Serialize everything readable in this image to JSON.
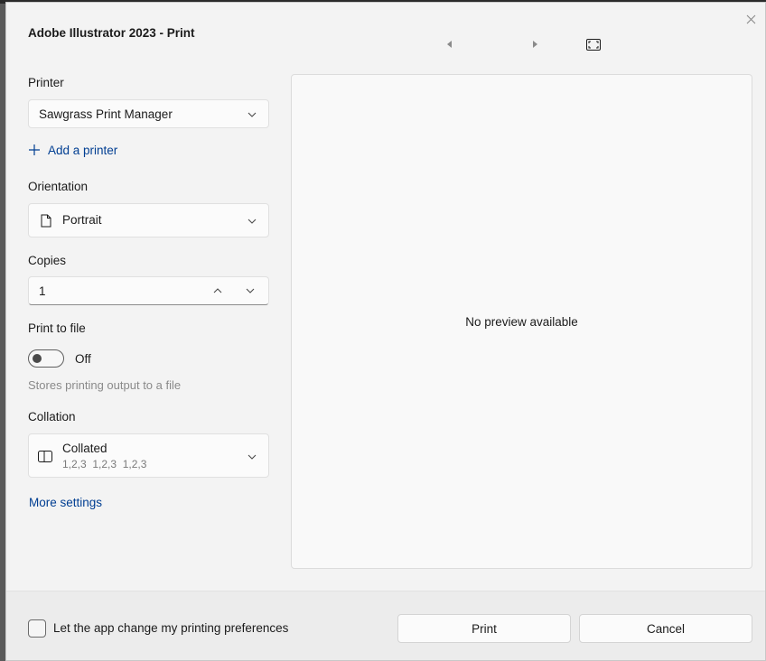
{
  "window": {
    "title": "Adobe Illustrator 2023 - Print"
  },
  "printer": {
    "label": "Printer",
    "selected": "Sawgrass Print Manager",
    "add_label": "Add a printer"
  },
  "orientation": {
    "label": "Orientation",
    "selected": "Portrait"
  },
  "copies": {
    "label": "Copies",
    "value": "1"
  },
  "print_to_file": {
    "label": "Print to file",
    "state": "Off",
    "hint": "Stores printing output to a file"
  },
  "collation": {
    "label": "Collation",
    "selected": "Collated",
    "detail": "1,2,3  1,2,3  1,2,3"
  },
  "more_settings": "More settings",
  "preview": {
    "message": "No preview available"
  },
  "footer": {
    "checkbox_label": "Let the app change my printing preferences",
    "print_label": "Print",
    "cancel_label": "Cancel"
  },
  "colors": {
    "link": "#003e92",
    "dialog_bg": "#f3f3f3",
    "hint": "#8a8a8a"
  }
}
